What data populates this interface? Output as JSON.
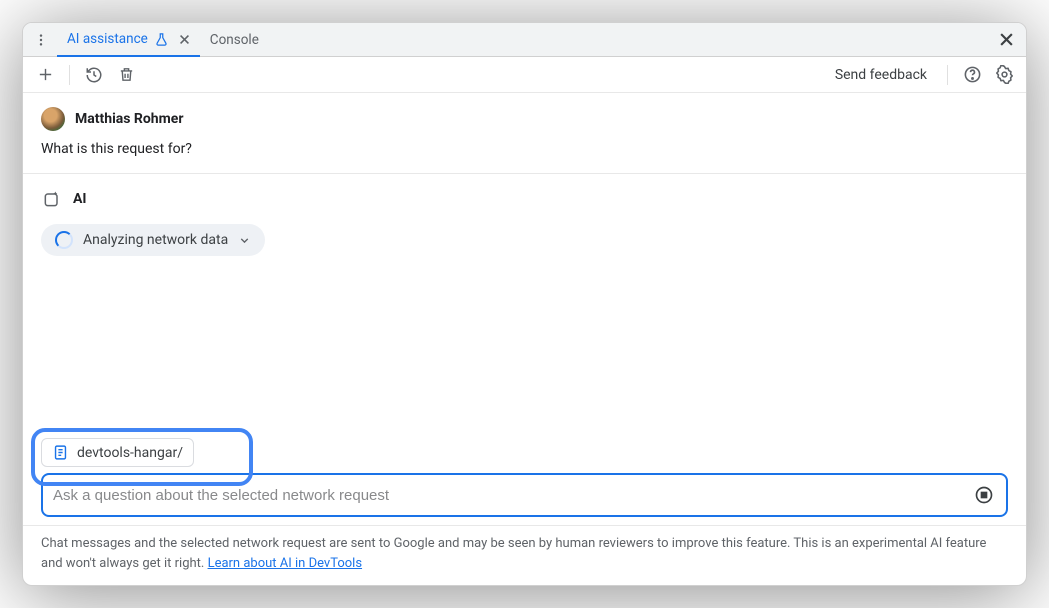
{
  "tabs": {
    "ai": "AI assistance",
    "console": "Console"
  },
  "toolbar": {
    "feedback": "Send feedback"
  },
  "user": {
    "name": "Matthias Rohmer",
    "message": "What is this request for?"
  },
  "ai": {
    "label": "AI",
    "status": "Analyzing network data"
  },
  "context": {
    "label": "devtools-hangar/"
  },
  "input": {
    "placeholder": "Ask a question about the selected network request"
  },
  "footer": {
    "text": "Chat messages and the selected network request are sent to Google and may be seen by human reviewers to improve this feature. This is an experimental AI feature and won't always get it right. ",
    "link": "Learn about AI in DevTools"
  }
}
